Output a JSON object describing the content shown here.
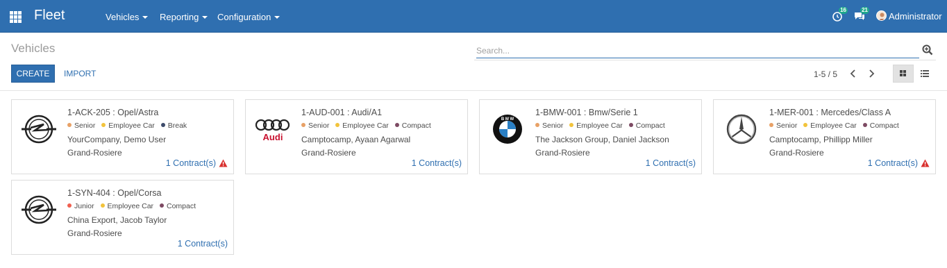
{
  "navbar": {
    "brand": "Fleet",
    "menus": [
      "Vehicles",
      "Reporting",
      "Configuration"
    ],
    "activity_count": "16",
    "messages_count": "21",
    "user": "Administrator"
  },
  "control": {
    "breadcrumb": "Vehicles",
    "search_placeholder": "Search...",
    "create_label": "CREATE",
    "import_label": "IMPORT",
    "pager": "1-5 / 5"
  },
  "colors": {
    "navbar": "#2f6fb0",
    "link": "#2f6fb0",
    "warning": "#d9302e"
  },
  "vehicles": [
    {
      "title": "1-ACK-205 : Opel/Astra",
      "logo": "opel-logo",
      "tags": [
        {
          "label": "Senior",
          "color": "#e8a166"
        },
        {
          "label": "Employee Car",
          "color": "#f2c33b"
        },
        {
          "label": "Break",
          "color": "#3d4b6b"
        }
      ],
      "owner": "YourCompany, Demo User",
      "location": "Grand-Rosiere",
      "contracts": "1 Contract(s)",
      "warning": true
    },
    {
      "title": "1-AUD-001 : Audi/A1",
      "logo": "audi-logo",
      "tags": [
        {
          "label": "Senior",
          "color": "#e8a166"
        },
        {
          "label": "Employee Car",
          "color": "#f2c33b"
        },
        {
          "label": "Compact",
          "color": "#7d4a63"
        }
      ],
      "owner": "Camptocamp, Ayaan Agarwal",
      "location": "Grand-Rosiere",
      "contracts": "1 Contract(s)",
      "warning": false
    },
    {
      "title": "1-BMW-001 : Bmw/Serie 1",
      "logo": "bmw-logo",
      "tags": [
        {
          "label": "Senior",
          "color": "#e8a166"
        },
        {
          "label": "Employee Car",
          "color": "#f2c33b"
        },
        {
          "label": "Compact",
          "color": "#7d4a63"
        }
      ],
      "owner": "The Jackson Group, Daniel Jackson",
      "location": "Grand-Rosiere",
      "contracts": "1 Contract(s)",
      "warning": false
    },
    {
      "title": "1-MER-001 : Mercedes/Class A",
      "logo": "mercedes-logo",
      "tags": [
        {
          "label": "Senior",
          "color": "#e8a166"
        },
        {
          "label": "Employee Car",
          "color": "#f2c33b"
        },
        {
          "label": "Compact",
          "color": "#7d4a63"
        }
      ],
      "owner": "Camptocamp, Phillipp Miller",
      "location": "Grand-Rosiere",
      "contracts": "1 Contract(s)",
      "warning": true
    },
    {
      "title": "1-SYN-404 : Opel/Corsa",
      "logo": "opel-logo",
      "tags": [
        {
          "label": "Junior",
          "color": "#f06050"
        },
        {
          "label": "Employee Car",
          "color": "#f2c33b"
        },
        {
          "label": "Compact",
          "color": "#7d4a63"
        }
      ],
      "owner": "China Export, Jacob Taylor",
      "location": "Grand-Rosiere",
      "contracts": "1 Contract(s)",
      "warning": false
    }
  ]
}
